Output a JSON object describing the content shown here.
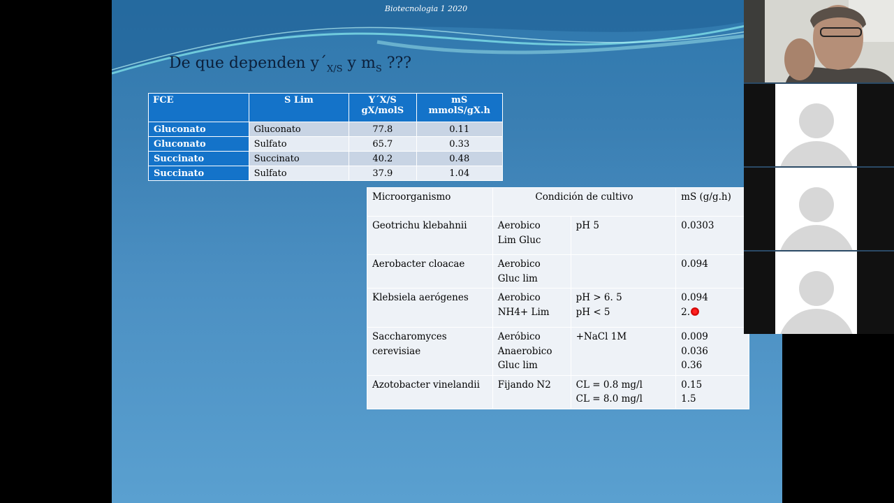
{
  "slide": {
    "header": "Biotecnologia 1 2020",
    "title_prefix": "De que dependen y´",
    "title_sub1": "X/S",
    "title_mid": " y m",
    "title_sub2": "S",
    "title_suffix": "  ???"
  },
  "table1": {
    "headers": {
      "col1": "FCE",
      "col2": "S Lim",
      "col3_line1": "Y´X/S",
      "col3_line2": "gX/molS",
      "col4_line1": "mS",
      "col4_line2": "mmolS/gX.h"
    },
    "rows": [
      {
        "fce": "Gluconato",
        "slim": "Gluconato",
        "y": "77.8",
        "m": "0.11"
      },
      {
        "fce": "Gluconato",
        "slim": "Sulfato",
        "y": "65.7",
        "m": "0.33"
      },
      {
        "fce": "Succinato",
        "slim": "Succinato",
        "y": "40.2",
        "m": "0.48"
      },
      {
        "fce": "Succinato",
        "slim": "Sulfato",
        "y": "37.9",
        "m": "1.04"
      }
    ]
  },
  "table2": {
    "headers": {
      "micro": "Microorganismo",
      "cond": "Condición de cultivo",
      "ms": "mS (g/g.h)"
    },
    "rows": [
      {
        "micro": "Geotrichu klebahnii",
        "c1a": "Aerobico",
        "c1b": "Lim Gluc",
        "c1c": "",
        "c2a": "pH 5",
        "c2b": "",
        "m1": "0.0303",
        "m2": "",
        "m3": ""
      },
      {
        "micro": "Aerobacter cloacae",
        "c1a": "Aerobico",
        "c1b": "Gluc lim",
        "c1c": "",
        "c2a": "",
        "c2b": "",
        "m1": "0.094",
        "m2": "",
        "m3": ""
      },
      {
        "micro": "Klebsiela aerógenes",
        "c1a": "Aerobico",
        "c1b": "NH4+ Lim",
        "c1c": "",
        "c2a": "pH > 6. 5",
        "c2b": "pH < 5",
        "m1": "0.094",
        "m2": "2.",
        "m3": ""
      },
      {
        "micro": "Saccharomyces cerevisiae",
        "c1a": "Aeróbico",
        "c1b": "Anaerobico",
        "c1c": "Gluc lim",
        "c2a": "+NaCl 1M",
        "c2b": "",
        "m1": "0.009",
        "m2": "0.036",
        "m3": "0.36"
      },
      {
        "micro": "Azotobacter vinelandii",
        "c1a": "Fijando N2",
        "c1b": "",
        "c1c": "",
        "c2a": "CL = 0.8 mg/l",
        "c2b": "CL = 8.0 mg/l",
        "m1": "0.15",
        "m2": "1.5",
        "m3": ""
      }
    ]
  }
}
